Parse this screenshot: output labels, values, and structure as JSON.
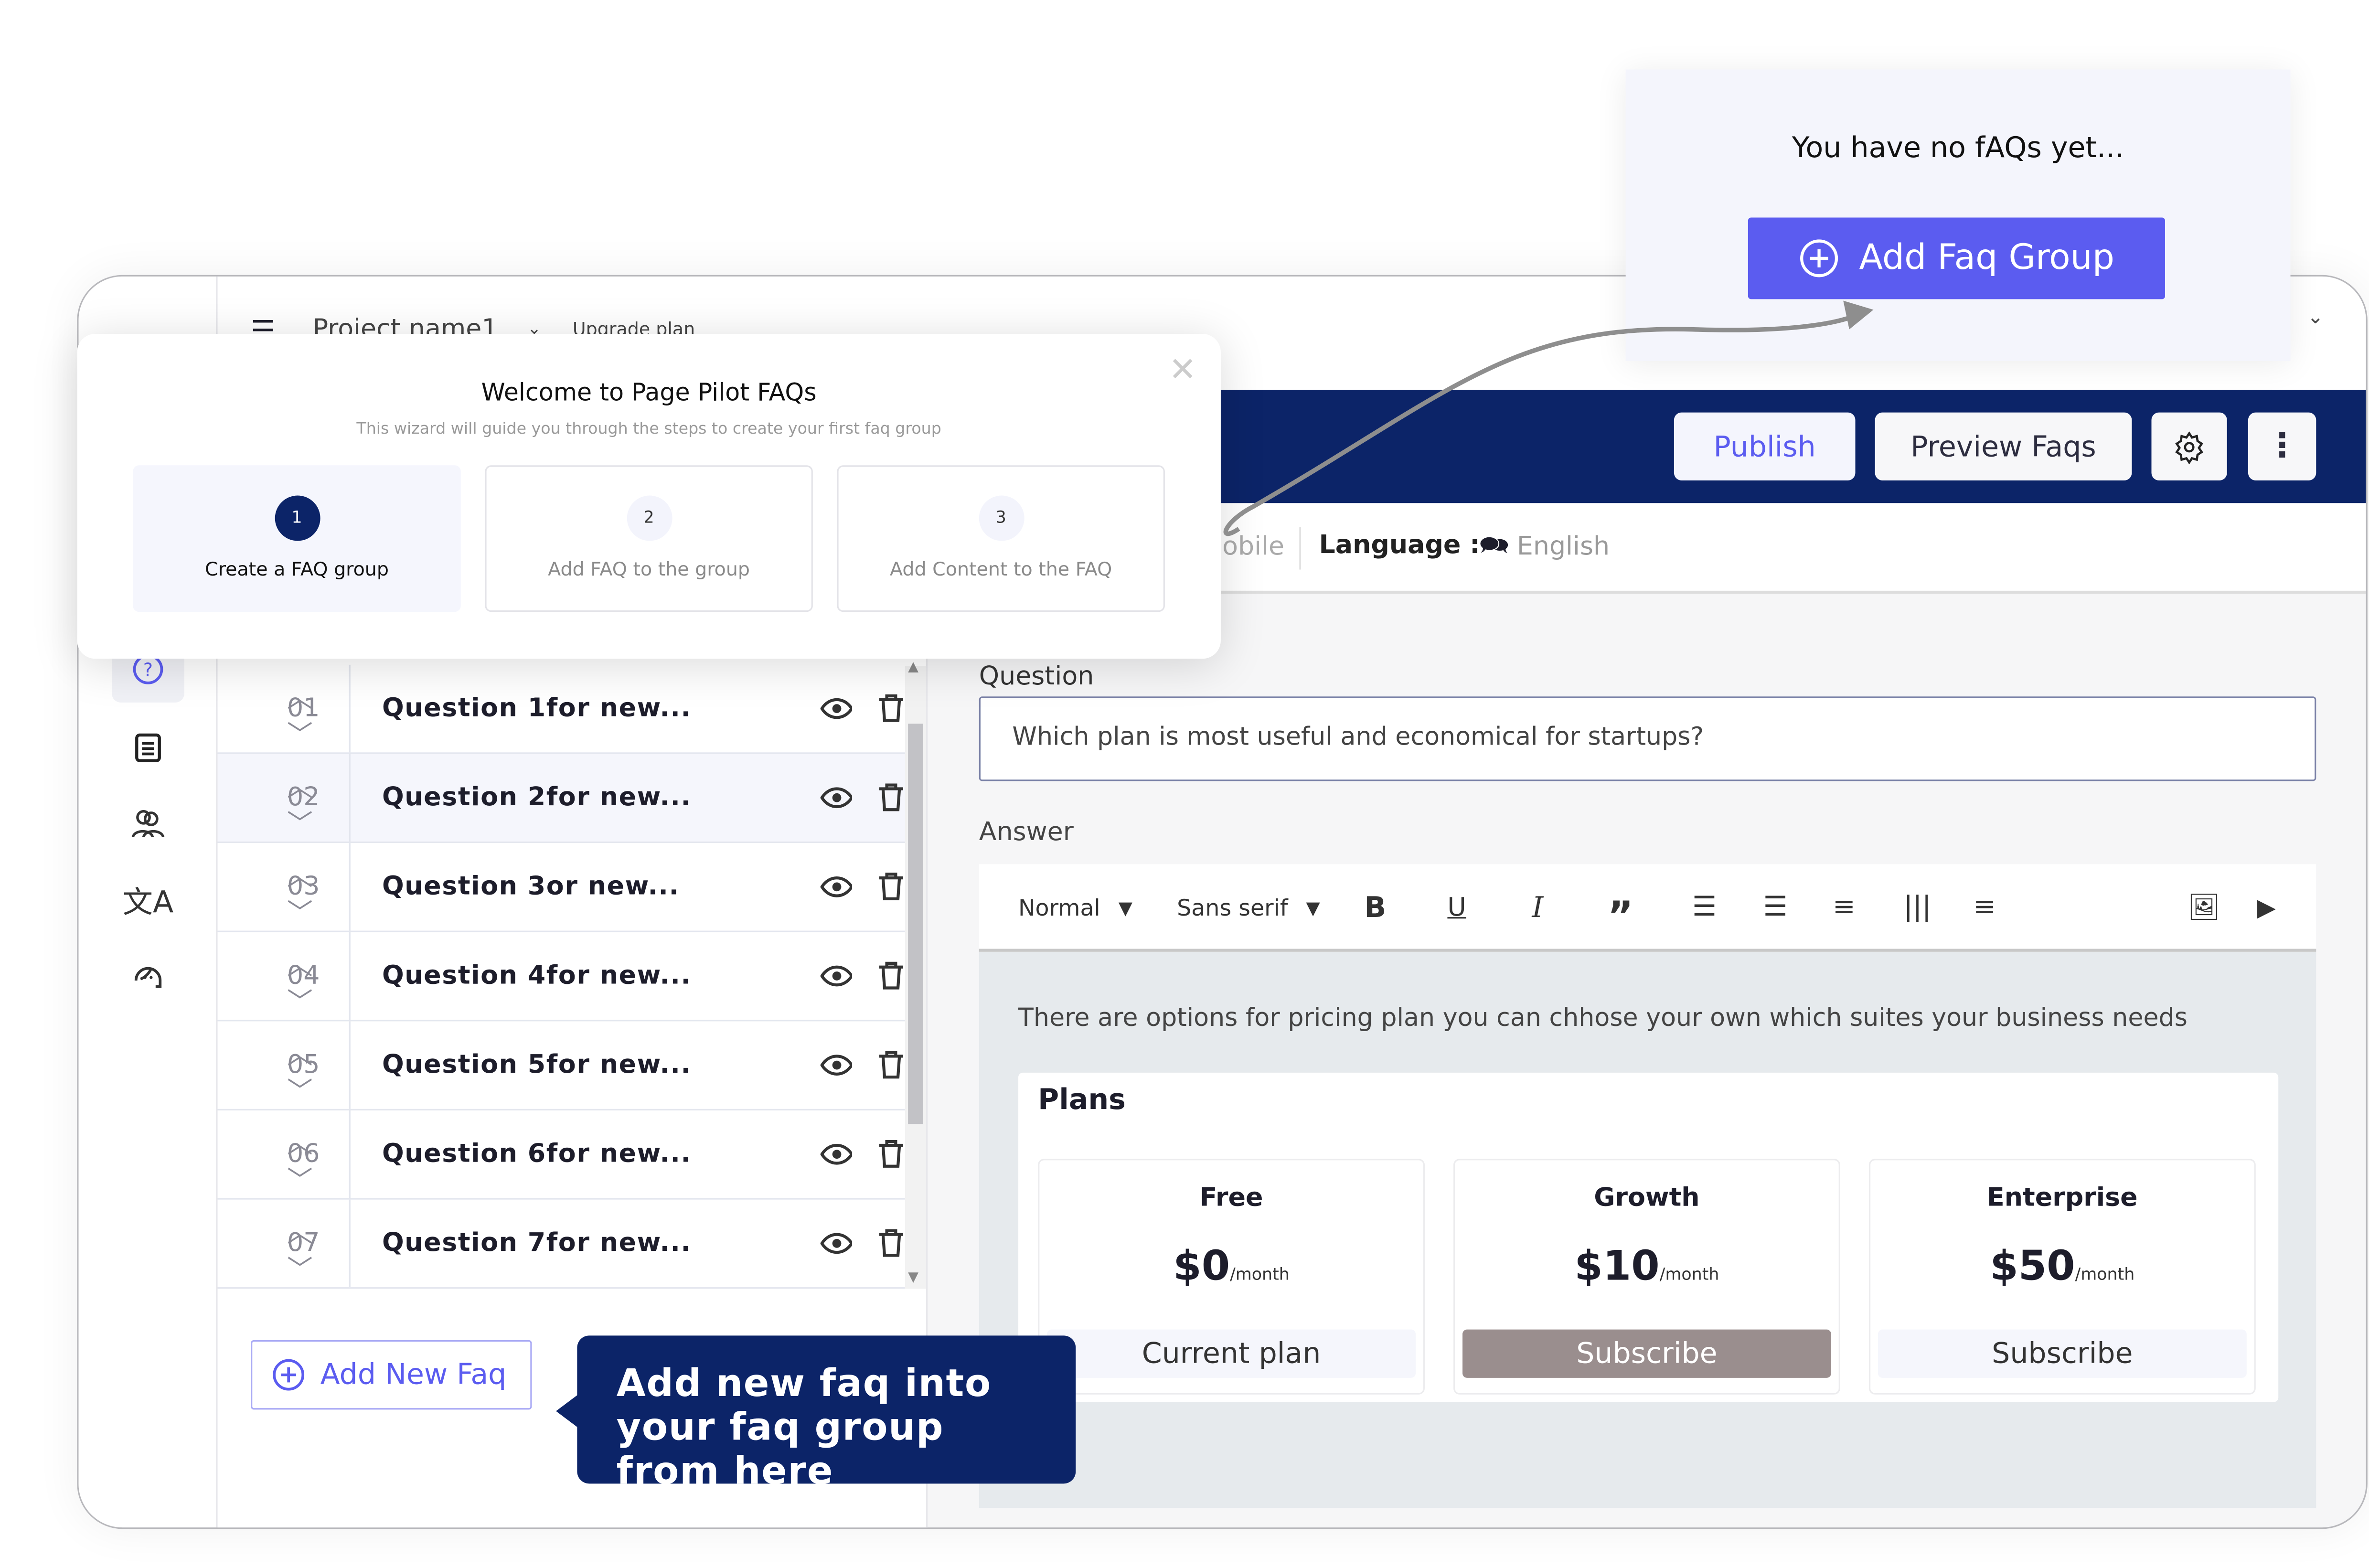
{
  "header": {
    "project_name": "Project name1",
    "upgrade_label": "Upgrade plan",
    "publish_label": "Publish",
    "preview_label": "Preview Faqs"
  },
  "subbar": {
    "device_partial": "obile",
    "language_label": "Language :",
    "language_value": "English"
  },
  "sidebar": {
    "items": [
      {
        "icon": "help-icon",
        "active": true
      },
      {
        "icon": "document-icon"
      },
      {
        "icon": "users-icon"
      },
      {
        "icon": "translate-icon"
      },
      {
        "icon": "support-agent-icon"
      }
    ]
  },
  "faq_list": {
    "items": [
      {
        "num": "01",
        "question": "Question 1for new..."
      },
      {
        "num": "02",
        "question": "Question 2for new..."
      },
      {
        "num": "03",
        "question": "Question 3or new..."
      },
      {
        "num": "04",
        "question": "Question 4for new..."
      },
      {
        "num": "05",
        "question": "Question 5for new..."
      },
      {
        "num": "06",
        "question": "Question 6for new..."
      },
      {
        "num": "07",
        "question": "Question 7for new..."
      }
    ],
    "add_label": "Add New Faq",
    "tooltip": "Add new faq into your faq group from here"
  },
  "editor": {
    "question_label": "Question",
    "question_value": "Which plan is most useful and economical for startups?",
    "answer_label": "Answer",
    "toolbar": {
      "format": "Normal",
      "font": "Sans serif"
    },
    "answer_text": "There are options for pricing plan you can chhose your own which suites your business needs",
    "plans_title": "Plans",
    "plans": [
      {
        "name": "Free",
        "price": "$0",
        "period": "/month",
        "button": "Current plan"
      },
      {
        "name": "Growth",
        "price": "$10",
        "period": "/month",
        "button": "Subscribe"
      },
      {
        "name": "Enterprise",
        "price": "$50",
        "period": "/month",
        "button": "Subscribe"
      }
    ]
  },
  "wizard": {
    "title": "Welcome to Page Pilot FAQs",
    "subtitle": "This wizard will guide you through the steps to create your first faq group",
    "steps": [
      {
        "num": "1",
        "label": "Create a FAQ group",
        "active": true
      },
      {
        "num": "2",
        "label": "Add FAQ to the group"
      },
      {
        "num": "3",
        "label": "Add Content to the FAQ"
      }
    ]
  },
  "empty_popup": {
    "message": "You have no fAQs yet...",
    "button": "Add Faq Group"
  },
  "colors": {
    "navy": "#0c2468",
    "accent": "#5b5cf0",
    "growth_button": "#9a8e8e"
  }
}
